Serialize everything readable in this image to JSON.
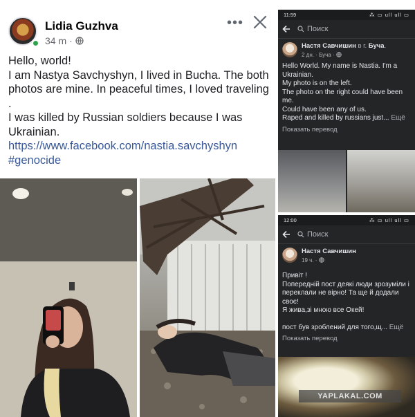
{
  "left_post": {
    "author": "Lidia Guzhva",
    "time": "34 m",
    "separator": "·",
    "more_label": "•••",
    "close_label": "✕",
    "lines": [
      "Hello, world!",
      "I am Nastya Savchyshyn, I lived in Bucha. The both photos are mine. In peaceful times, I loved traveling .",
      "I was killed by Russian soldiers because I was Ukrainian."
    ],
    "link": "https://www.facebook.com/nastia.savchyshyn",
    "hashtag": "#genocide",
    "icons": {
      "globe": "globe-icon",
      "close": "close-icon",
      "more": "more-icon"
    }
  },
  "phone_top": {
    "status_time": "11:59",
    "status_right": "⁂ ▭ ull ull ▭",
    "search_label": "Поиск",
    "author": "Настя Савчишин",
    "location_prefix": " в г. ",
    "location": "Буча",
    "location_suffix": ".",
    "meta": "2 дн. · Буча · ",
    "text_lines": [
      "Hello World. My name is Nastia. I'm a Ukrainian.",
      "My photo is on the left.",
      "The photo on the right could have been me.",
      "Could have been any of us."
    ],
    "last_line": "Raped and killed by russians just... ",
    "more_label": "Ещё",
    "translate": "Показать перевод"
  },
  "phone_bottom": {
    "status_time": "12:00",
    "status_right": "⁂ ▭ ull ull ▭",
    "search_label": "Поиск",
    "author": "Настя Савчишин",
    "meta": "19 ч. · ",
    "text_lines": [
      "Привіт !",
      "Попередній пост деякі люди зрозуміли і переклали не вірно! Та ще й додали своє!",
      "Я жива,зі мною все Окей!"
    ],
    "last_line": "пост був зроблений для того,щ... ",
    "more_label": "Ещё",
    "translate": "Показать перевод",
    "watermark": "YAPLAKAL.COM"
  }
}
